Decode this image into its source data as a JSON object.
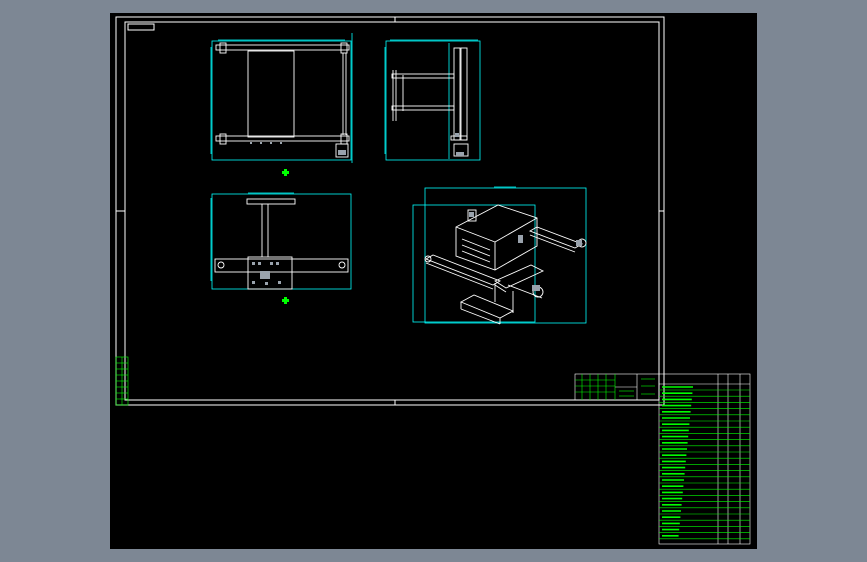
{
  "app": {
    "background_color": "#7d8794",
    "canvas_color": "#000000"
  },
  "palette": {
    "frame": "#ffffff",
    "cyan": "#00ffff",
    "green": "#00ff00",
    "part": "#ffffff",
    "grey": "#9aa3ad"
  },
  "drawing": {
    "views": [
      "top-view",
      "side-view",
      "front-view",
      "isometric-view"
    ],
    "markers": [
      "view-marker-top",
      "view-marker-front"
    ],
    "tables": [
      "title-block",
      "bill-of-materials",
      "revision-table"
    ]
  }
}
